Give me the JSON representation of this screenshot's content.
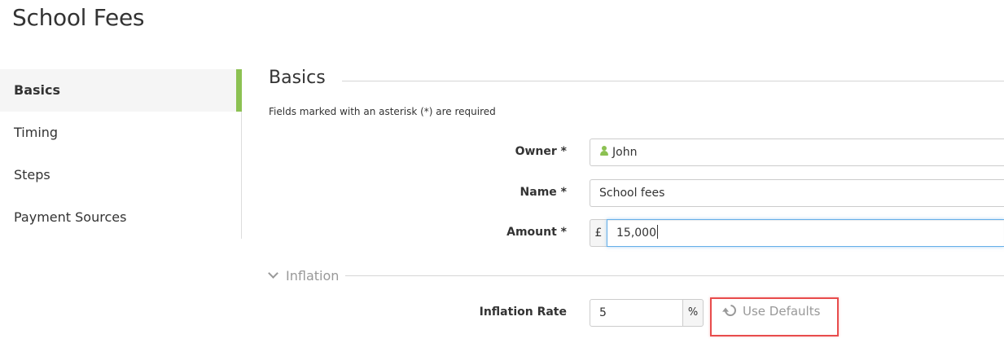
{
  "page_title": "School Fees",
  "sidebar": {
    "items": [
      {
        "label": "Basics",
        "active": true
      },
      {
        "label": "Timing",
        "active": false
      },
      {
        "label": "Steps",
        "active": false
      },
      {
        "label": "Payment Sources",
        "active": false
      }
    ]
  },
  "basics": {
    "heading": "Basics",
    "required_note": "Fields marked with an asterisk (*) are required",
    "owner": {
      "label": "Owner *",
      "value": "John",
      "icon": "user-icon"
    },
    "name": {
      "label": "Name *",
      "value": "School fees"
    },
    "amount": {
      "label": "Amount *",
      "currency": "£",
      "value": "15,000"
    }
  },
  "inflation": {
    "toggle_label": "Inflation",
    "rate": {
      "label": "Inflation Rate",
      "value": "5",
      "unit": "%"
    },
    "use_defaults_label": "Use Defaults"
  },
  "colors": {
    "accent": "#8cc152",
    "highlight_box": "#e84c4c",
    "focus": "#66afe9"
  }
}
